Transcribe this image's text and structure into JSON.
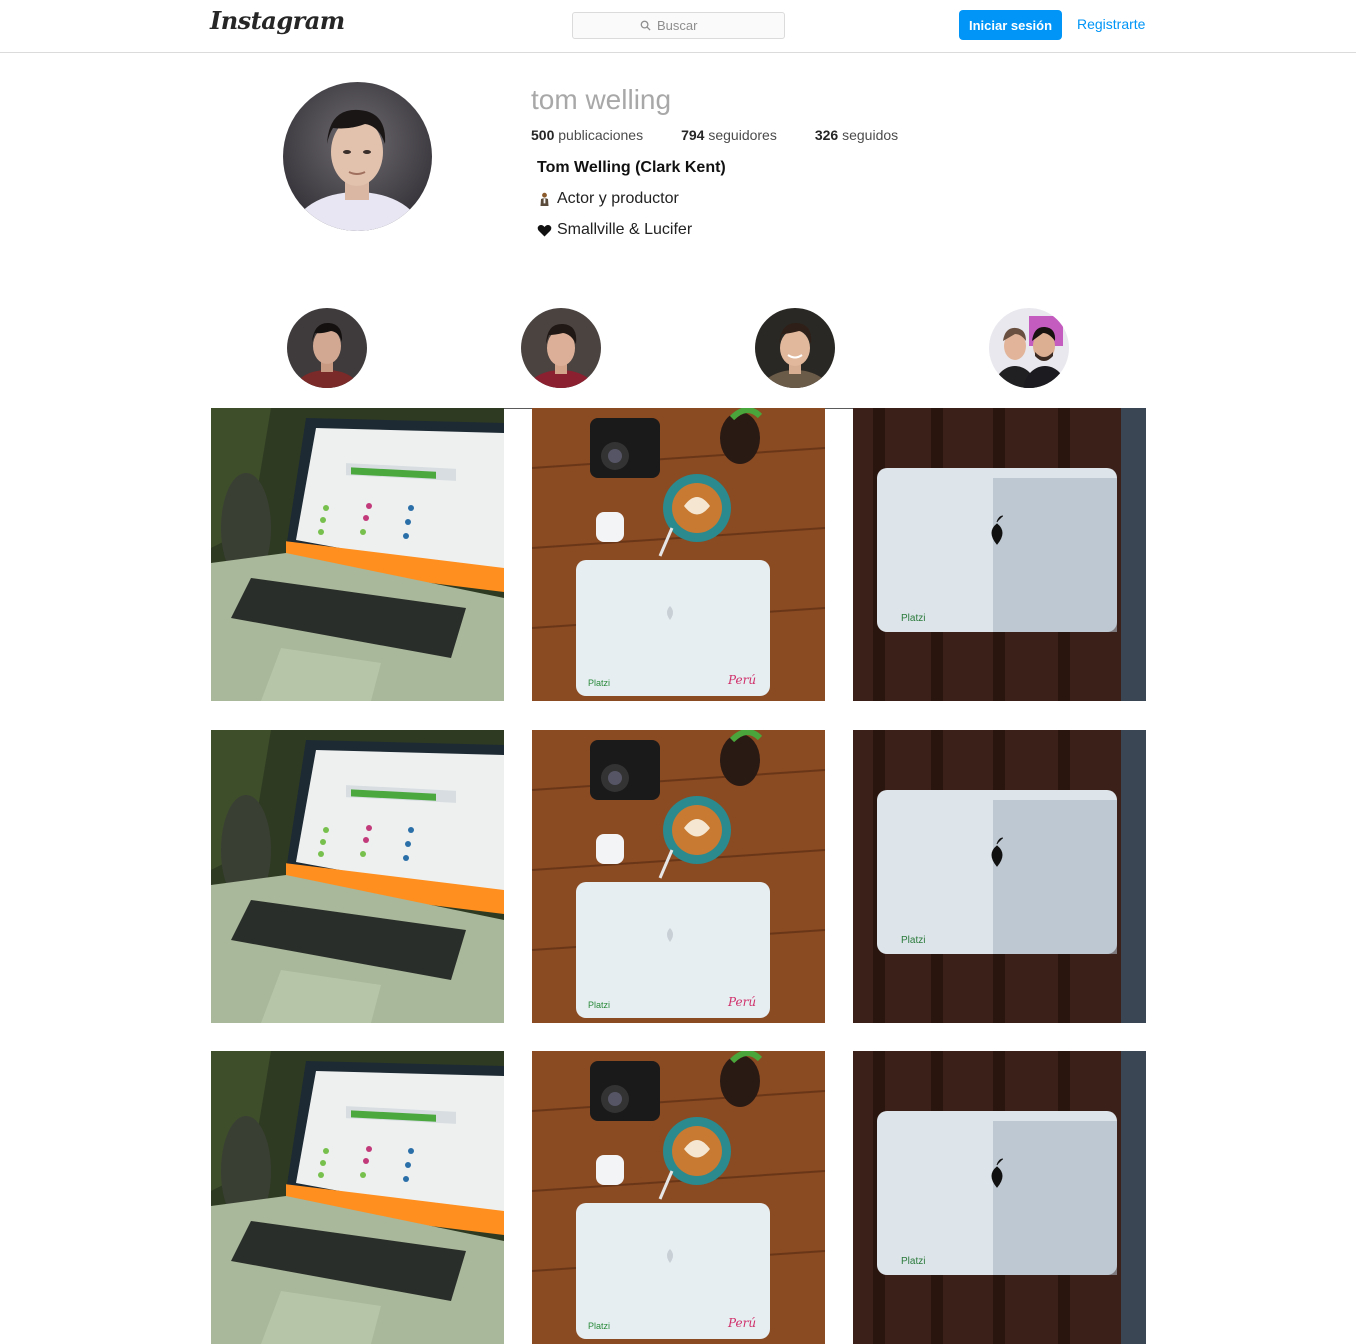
{
  "header": {
    "logo_text": "Instagram",
    "search_placeholder": "Buscar",
    "login_label": "Iniciar sesión",
    "signup_label": "Registrarte"
  },
  "profile": {
    "username": "tom welling",
    "stats": [
      {
        "count": "500",
        "label": "publicaciones"
      },
      {
        "count": "794",
        "label": "seguidores"
      },
      {
        "count": "326",
        "label": "seguidos"
      }
    ],
    "bio_name": "Tom Welling (Clark Kent)",
    "bio_lines": [
      {
        "icon": "person-icon",
        "text": "Actor y productor"
      },
      {
        "icon": "heart-icon",
        "text": "Smallville & Lucifer"
      }
    ]
  },
  "highlights": [
    {
      "image": "portrait-dark-hair"
    },
    {
      "image": "portrait-red-shirt"
    },
    {
      "image": "portrait-smiling"
    },
    {
      "image": "portrait-two-men"
    }
  ],
  "posts": [
    {
      "image": "laptop-platzi-screen"
    },
    {
      "image": "laptop-coffee-camera-table",
      "sticker_text": "Platzi",
      "sticker2_text": "Perú"
    },
    {
      "image": "laptop-lid-platzi",
      "sticker_text": "Platzi"
    },
    {
      "image": "laptop-platzi-screen"
    },
    {
      "image": "laptop-coffee-camera-table",
      "sticker_text": "Platzi",
      "sticker2_text": "Perú"
    },
    {
      "image": "laptop-lid-platzi",
      "sticker_text": "Platzi"
    },
    {
      "image": "laptop-platzi-screen"
    },
    {
      "image": "laptop-coffee-camera-table",
      "sticker_text": "Platzi",
      "sticker2_text": "Perú"
    },
    {
      "image": "laptop-lid-platzi",
      "sticker_text": "Platzi"
    }
  ],
  "colors": {
    "accent": "#0095f6",
    "border": "#dbdbdb",
    "muted_text": "#a8a8a8"
  }
}
